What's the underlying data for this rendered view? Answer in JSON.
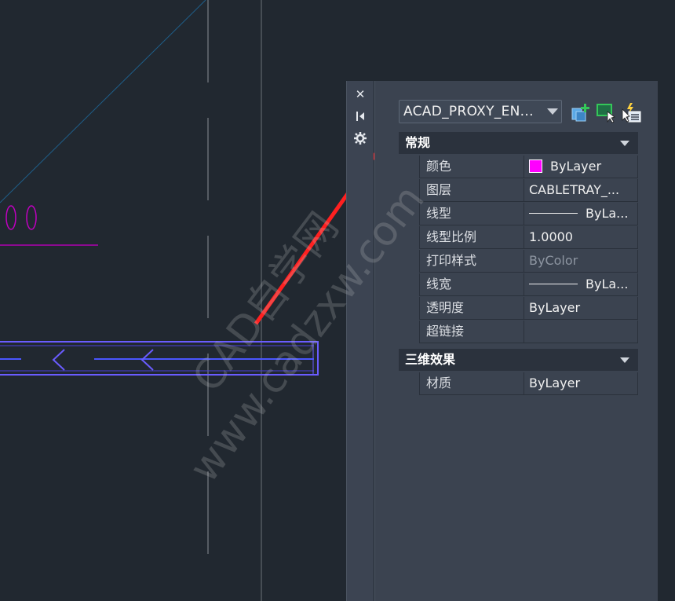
{
  "palette": {
    "object_type": "ACAD_PROXY_EN...",
    "tool_icons": [
      "quick-select-icon",
      "select-objects-icon",
      "toggle-pickadd-icon"
    ],
    "strip_icons": [
      "close-icon",
      "auto-hide-icon",
      "properties-settings-icon"
    ],
    "sections": [
      {
        "title": "常规",
        "rows": [
          {
            "name": "颜色",
            "value": "ByLayer",
            "swatch": "#ff00ff"
          },
          {
            "name": "图层",
            "value": "CABLETRAY_..."
          },
          {
            "name": "线型",
            "value": "ByLa..."
          },
          {
            "name": "线型比例",
            "value": "1.0000"
          },
          {
            "name": "打印样式",
            "value": "ByColor"
          },
          {
            "name": "线宽",
            "value": "ByLa..."
          },
          {
            "name": "透明度",
            "value": "ByLayer"
          },
          {
            "name": "超链接",
            "value": ""
          }
        ]
      },
      {
        "title": "三维效果",
        "rows": [
          {
            "name": "材质",
            "value": "ByLayer"
          }
        ]
      }
    ]
  },
  "watermark": {
    "line1": "CAD自学网",
    "line2": "www.cadzxw.com"
  },
  "colors": {
    "background": "#212830",
    "panel": "#3b4350",
    "accent_arrow": "#ff2020",
    "entity_magenta": "#c000c0",
    "tray_blue": "#6a5cff"
  }
}
